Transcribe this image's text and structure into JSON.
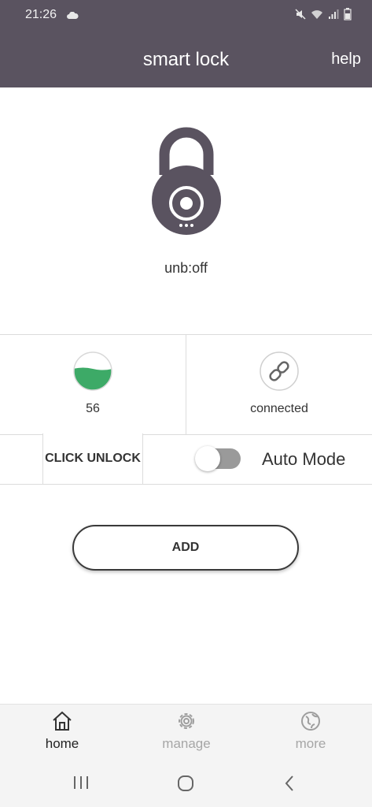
{
  "status_bar": {
    "time": "21:26",
    "weather_icon": "cloud-icon",
    "indicators": [
      "mute-icon",
      "wifi-icon",
      "signal-icon",
      "battery-icon"
    ]
  },
  "app_bar": {
    "title": "smart lock",
    "help_label": "help"
  },
  "lock": {
    "icon": "padlock-icon",
    "status_text": "unb:off"
  },
  "info": {
    "battery_value": "56",
    "battery_fill_fraction": 0.56,
    "battery_color": "#3daa67",
    "connection_icon": "link-icon",
    "connection_label": "connected"
  },
  "controls": {
    "click_unlock_label": "CLICK UNLOCK",
    "auto_mode_label": "Auto Mode",
    "auto_mode_on": false
  },
  "actions": {
    "add_label": "ADD"
  },
  "tabs": [
    {
      "label": "home",
      "icon": "home-icon",
      "active": true
    },
    {
      "label": "manage",
      "icon": "gear-icon",
      "active": false
    },
    {
      "label": "more",
      "icon": "globe-icon",
      "active": false
    }
  ],
  "system_nav": [
    "recent-apps-icon",
    "home-circle-icon",
    "back-icon"
  ],
  "colors": {
    "header_bg": "#5a5360",
    "lock_body": "#5a5360",
    "accent_green": "#3daa67"
  }
}
